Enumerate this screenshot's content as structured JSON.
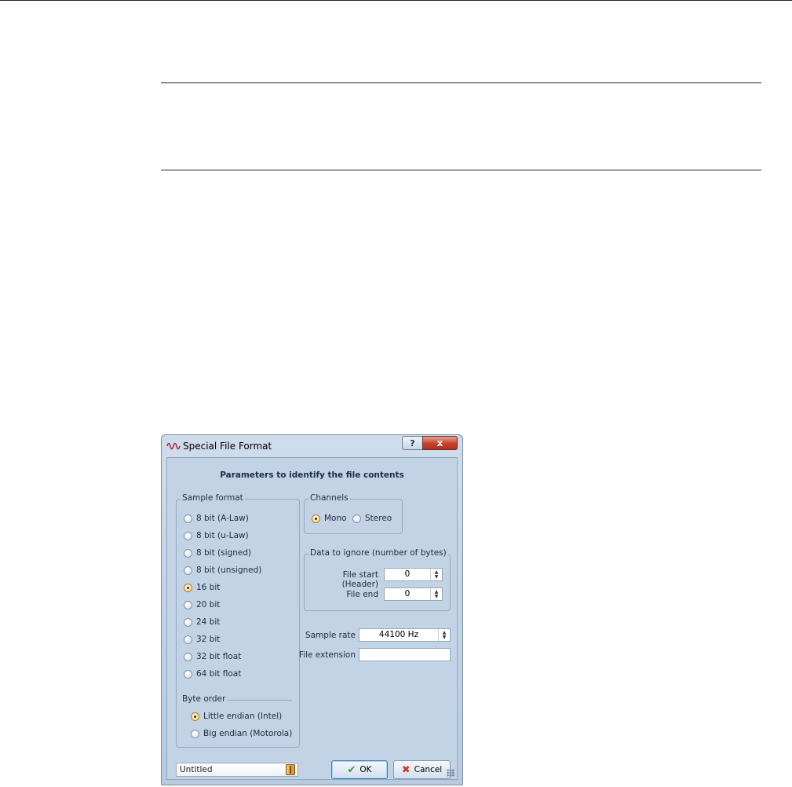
{
  "dialog": {
    "title": "Special File Format",
    "help_button": "?",
    "close_button": "x",
    "heading": "Parameters to identify the file contents"
  },
  "sample_format": {
    "label": "Sample format",
    "options": [
      "8 bit (A-Law)",
      "8 bit (u-Law)",
      "8 bit (signed)",
      "8 bit (unsigned)",
      "16 bit",
      "20 bit",
      "24 bit",
      "32 bit",
      "32 bit float",
      "64 bit float"
    ],
    "selected": "16 bit"
  },
  "byte_order": {
    "label": "Byte order",
    "options": [
      "Little endian (Intel)",
      "Big endian (Motorola)"
    ],
    "selected": "Little endian (Intel)"
  },
  "channels": {
    "label": "Channels",
    "options": [
      "Mono",
      "Stereo"
    ],
    "selected": "Mono"
  },
  "data_to_ignore": {
    "label": "Data to ignore (number of bytes)",
    "file_start_label": "File start (Header)",
    "file_start_value": "0",
    "file_end_label": "File end",
    "file_end_value": "0"
  },
  "sample_rate": {
    "label": "Sample rate",
    "value": "44100 Hz"
  },
  "file_extension": {
    "label": "File extension",
    "value": ""
  },
  "preset": {
    "value": "Untitled"
  },
  "buttons": {
    "ok": "OK",
    "cancel": "Cancel"
  },
  "colors": {
    "dialog_bg": "#c3d3e6",
    "close_red": "#c4412c",
    "radio_selected": "#f2cf7a",
    "ok_check": "#3a9a2a",
    "cancel_x": "#d23a2a"
  }
}
